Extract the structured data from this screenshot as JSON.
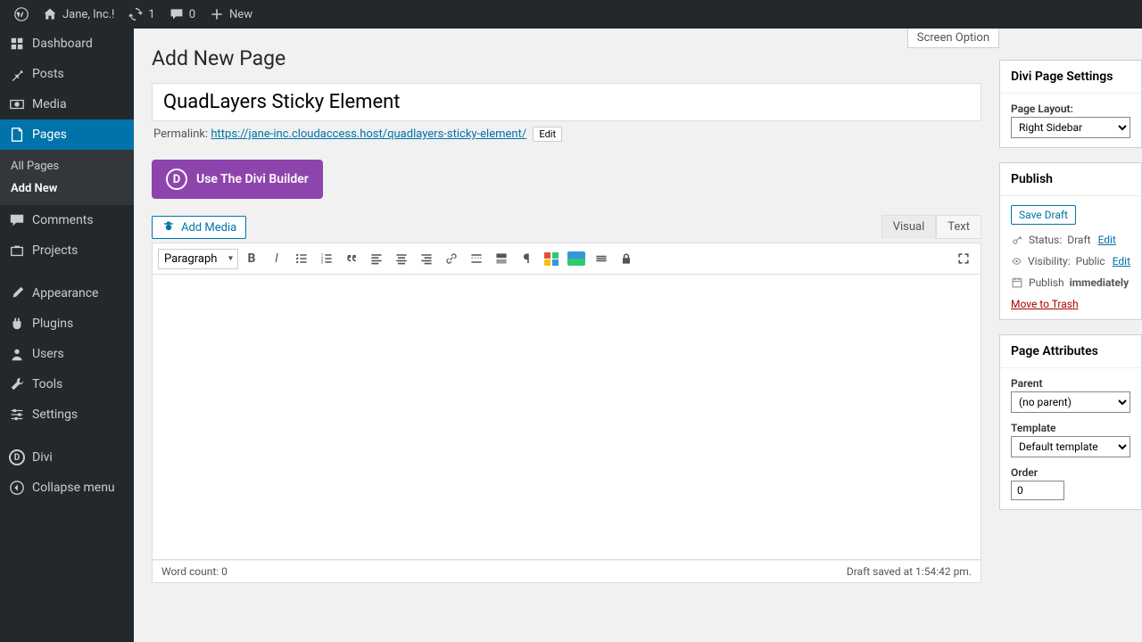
{
  "topbar": {
    "site_name": "Jane, Inc.!",
    "updates_count": "1",
    "comments_count": "0",
    "new_label": "New"
  },
  "sidebar": {
    "dashboard": "Dashboard",
    "posts": "Posts",
    "media": "Media",
    "pages": "Pages",
    "pages_sub": {
      "all": "All Pages",
      "add_new": "Add New"
    },
    "comments": "Comments",
    "projects": "Projects",
    "appearance": "Appearance",
    "plugins": "Plugins",
    "users": "Users",
    "tools": "Tools",
    "settings": "Settings",
    "divi": "Divi",
    "collapse": "Collapse menu"
  },
  "main": {
    "screen_options": "Screen Option",
    "heading": "Add New Page",
    "title_value": "QuadLayers Sticky Element",
    "permalink_label": "Permalink:",
    "permalink_url": "https://jane-inc.cloudaccess.host/quadlayers-sticky-element/",
    "edit_btn": "Edit",
    "divi_button": "Use The Divi Builder",
    "add_media": "Add Media",
    "tabs": {
      "visual": "Visual",
      "text": "Text"
    },
    "format_selected": "Paragraph",
    "word_count_label": "Word count: 0",
    "draft_saved": "Draft saved at 1:54:42 pm."
  },
  "divi_settings": {
    "title": "Divi Page Settings",
    "layout_label": "Page Layout:",
    "layout_value": "Right Sidebar"
  },
  "publish": {
    "title": "Publish",
    "save_draft": "Save Draft",
    "status_label": "Status:",
    "status_value": "Draft",
    "visibility_label": "Visibility:",
    "visibility_value": "Public",
    "publish_label": "Publish",
    "publish_value": "immediately",
    "edit": "Edit",
    "trash": "Move to Trash"
  },
  "attributes": {
    "title": "Page Attributes",
    "parent_label": "Parent",
    "parent_value": "(no parent)",
    "template_label": "Template",
    "template_value": "Default template",
    "order_label": "Order",
    "order_value": "0"
  }
}
